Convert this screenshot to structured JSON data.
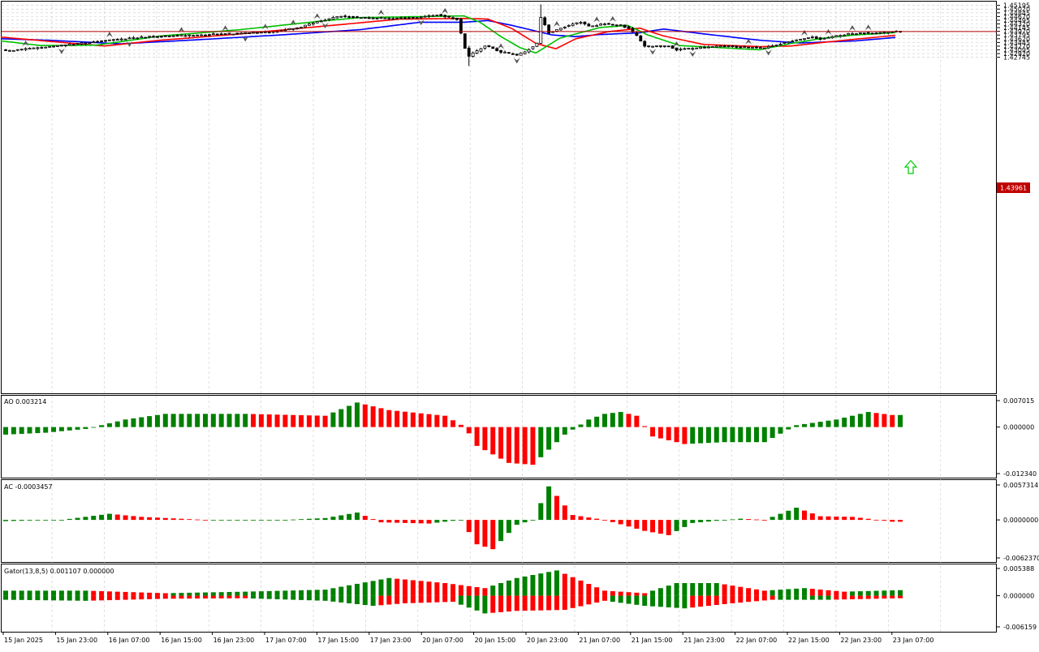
{
  "colors": {
    "bull": "#008000",
    "bear": "#ff0000",
    "alligator_lips": "#00c000",
    "alligator_teeth": "#ff0000",
    "alligator_jaw": "#0000ff",
    "price_line": "#b00000",
    "grid": "#c8c8c8",
    "signal_arrow": "#00cc00"
  },
  "main": {
    "price_badge": "1.43961",
    "signal_icon": "up-arrow-icon"
  },
  "panels": {
    "ao": {
      "label": "AO 0.003214"
    },
    "ac": {
      "label": "AC -0.0003457"
    },
    "gator": {
      "label": "Gator(13,8,5) 0.001107 0.000000"
    }
  },
  "chart_data": [
    {
      "type": "candlestick",
      "title": "",
      "ylim": [
        1.2692,
        1.4522
      ],
      "y_ticks": [
        "1.45195",
        "1.45020",
        "1.44845",
        "1.44670",
        "1.44495",
        "1.44320",
        "1.44145",
        "1.43970",
        "1.43795",
        "1.43620",
        "1.43445",
        "1.43270",
        "1.43095",
        "1.42920",
        "1.42745"
      ],
      "x_ticks": [
        "15 Jan 2025",
        "15 Jan 23:00",
        "16 Jan 07:00",
        "16 Jan 15:00",
        "16 Jan 23:00",
        "17 Jan 07:00",
        "17 Jan 15:00",
        "17 Jan 23:00",
        "20 Jan 07:00",
        "20 Jan 15:00",
        "20 Jan 23:00",
        "21 Jan 07:00",
        "21 Jan 15:00",
        "21 Jan 23:00",
        "22 Jan 07:00",
        "22 Jan 15:00",
        "22 Jan 23:00",
        "23 Jan 07:00"
      ],
      "current_price": 1.43961,
      "close_anchors": [
        [
          0,
          1.4305
        ],
        [
          12,
          1.4326
        ],
        [
          24,
          1.4352
        ],
        [
          36,
          1.4372
        ],
        [
          48,
          1.438
        ],
        [
          58,
          1.4387
        ],
        [
          66,
          1.4393
        ],
        [
          74,
          1.4418
        ],
        [
          78,
          1.4442
        ],
        [
          84,
          1.447
        ],
        [
          88,
          1.4462
        ],
        [
          96,
          1.4458
        ],
        [
          102,
          1.4462
        ],
        [
          108,
          1.4475
        ],
        [
          113,
          1.4455
        ],
        [
          115,
          1.4318
        ],
        [
          116,
          1.428
        ],
        [
          120,
          1.433
        ],
        [
          124,
          1.43
        ],
        [
          128,
          1.4285
        ],
        [
          130,
          1.43
        ],
        [
          133,
          1.434
        ],
        [
          134,
          1.4462
        ],
        [
          136,
          1.439
        ],
        [
          140,
          1.442
        ],
        [
          144,
          1.4442
        ],
        [
          146,
          1.442
        ],
        [
          150,
          1.4432
        ],
        [
          154,
          1.4425
        ],
        [
          156,
          1.441
        ],
        [
          158,
          1.4375
        ],
        [
          160,
          1.4325
        ],
        [
          166,
          1.433
        ],
        [
          168,
          1.431
        ],
        [
          174,
          1.432
        ],
        [
          180,
          1.4327
        ],
        [
          186,
          1.4322
        ],
        [
          190,
          1.4318
        ],
        [
          196,
          1.435
        ],
        [
          202,
          1.437
        ],
        [
          204,
          1.436
        ],
        [
          210,
          1.4382
        ],
        [
          214,
          1.439
        ],
        [
          218,
          1.4388
        ],
        [
          222,
          1.4396
        ]
      ],
      "lips_anchors": [
        [
          0,
          1.4352
        ],
        [
          10,
          1.433
        ],
        [
          24,
          1.4332
        ],
        [
          40,
          1.4375
        ],
        [
          60,
          1.4405
        ],
        [
          80,
          1.4445
        ],
        [
          90,
          1.4462
        ],
        [
          100,
          1.4465
        ],
        [
          116,
          1.447
        ],
        [
          120,
          1.444
        ],
        [
          125,
          1.4375
        ],
        [
          130,
          1.432
        ],
        [
          134,
          1.4295
        ],
        [
          140,
          1.4365
        ],
        [
          150,
          1.4415
        ],
        [
          157,
          1.4425
        ],
        [
          162,
          1.438
        ],
        [
          170,
          1.433
        ],
        [
          180,
          1.432
        ],
        [
          190,
          1.431
        ],
        [
          198,
          1.434
        ],
        [
          206,
          1.4365
        ],
        [
          214,
          1.438
        ],
        [
          224,
          1.4391
        ]
      ],
      "teeth_anchors": [
        [
          0,
          1.437
        ],
        [
          12,
          1.435
        ],
        [
          26,
          1.4328
        ],
        [
          40,
          1.4355
        ],
        [
          60,
          1.4385
        ],
        [
          80,
          1.442
        ],
        [
          100,
          1.4455
        ],
        [
          116,
          1.4458
        ],
        [
          122,
          1.4455
        ],
        [
          128,
          1.441
        ],
        [
          134,
          1.434
        ],
        [
          139,
          1.4315
        ],
        [
          144,
          1.4362
        ],
        [
          152,
          1.4395
        ],
        [
          160,
          1.4412
        ],
        [
          166,
          1.4375
        ],
        [
          176,
          1.4335
        ],
        [
          190,
          1.4325
        ],
        [
          198,
          1.4328
        ],
        [
          206,
          1.4345
        ],
        [
          214,
          1.436
        ],
        [
          224,
          1.4378
        ]
      ],
      "jaw_anchors": [
        [
          0,
          1.4362
        ],
        [
          12,
          1.4355
        ],
        [
          30,
          1.4338
        ],
        [
          50,
          1.4358
        ],
        [
          70,
          1.438
        ],
        [
          90,
          1.4405
        ],
        [
          105,
          1.444
        ],
        [
          116,
          1.444
        ],
        [
          122,
          1.4448
        ],
        [
          128,
          1.4425
        ],
        [
          138,
          1.438
        ],
        [
          144,
          1.4372
        ],
        [
          150,
          1.4382
        ],
        [
          160,
          1.439
        ],
        [
          166,
          1.4408
        ],
        [
          176,
          1.4385
        ],
        [
          190,
          1.4355
        ],
        [
          200,
          1.4342
        ],
        [
          214,
          1.4352
        ],
        [
          224,
          1.4368
        ]
      ]
    },
    {
      "type": "histogram",
      "title": "AO 0.003214",
      "ylim": [
        -0.01234,
        0.007015
      ],
      "y_ticks": [
        "0.007015",
        "0.000000",
        "-0.012340"
      ],
      "anchors": [
        [
          0,
          -0.002
        ],
        [
          10,
          -0.0015
        ],
        [
          20,
          -0.0005
        ],
        [
          30,
          0.002
        ],
        [
          40,
          0.0035
        ],
        [
          60,
          0.0035
        ],
        [
          80,
          0.003
        ],
        [
          88,
          0.0065
        ],
        [
          96,
          0.0045
        ],
        [
          110,
          0.003
        ],
        [
          115,
          0.0
        ],
        [
          118,
          -0.005
        ],
        [
          126,
          -0.0095
        ],
        [
          132,
          -0.01
        ],
        [
          140,
          -0.002
        ],
        [
          146,
          0.002
        ],
        [
          150,
          0.0035
        ],
        [
          154,
          0.004
        ],
        [
          158,
          0.003
        ],
        [
          162,
          -0.0025
        ],
        [
          170,
          -0.0045
        ],
        [
          180,
          -0.004
        ],
        [
          190,
          -0.004
        ],
        [
          198,
          0.0005
        ],
        [
          208,
          0.002
        ],
        [
          216,
          0.004
        ],
        [
          222,
          0.0032
        ]
      ]
    },
    {
      "type": "histogram",
      "title": "AC -0.0003457",
      "ylim": [
        -0.006237,
        0.0057314
      ],
      "y_ticks": [
        "0.0057314",
        "0.0000000",
        "-0.0062370"
      ],
      "anchors": [
        [
          0,
          -0.0002
        ],
        [
          14,
          0.0
        ],
        [
          20,
          0.0005
        ],
        [
          26,
          0.001
        ],
        [
          34,
          0.0005
        ],
        [
          50,
          0.0
        ],
        [
          70,
          0.0
        ],
        [
          80,
          0.0003
        ],
        [
          88,
          0.0012
        ],
        [
          94,
          -0.0004
        ],
        [
          106,
          -0.0006
        ],
        [
          114,
          0.0
        ],
        [
          118,
          -0.004
        ],
        [
          122,
          -0.0048
        ],
        [
          128,
          -0.0008
        ],
        [
          132,
          0.0
        ],
        [
          136,
          0.0055
        ],
        [
          142,
          0.0008
        ],
        [
          150,
          0.0
        ],
        [
          160,
          -0.0018
        ],
        [
          166,
          -0.0025
        ],
        [
          172,
          -0.0005
        ],
        [
          184,
          0.0002
        ],
        [
          190,
          0.0
        ],
        [
          198,
          0.002
        ],
        [
          204,
          0.0006
        ],
        [
          212,
          0.0005
        ],
        [
          222,
          -0.0003
        ]
      ]
    },
    {
      "type": "histogram",
      "title": "Gator(13,8,5) 0.001107 0.000000",
      "ylim": [
        -0.006159,
        0.005388
      ],
      "y_ticks": [
        "0.005388",
        "0.000000",
        "-0.006159"
      ],
      "upper_anchors": [
        [
          0,
          0.001
        ],
        [
          20,
          0.001
        ],
        [
          40,
          0.0005
        ],
        [
          60,
          0.0008
        ],
        [
          80,
          0.0012
        ],
        [
          96,
          0.0035
        ],
        [
          110,
          0.0025
        ],
        [
          120,
          0.0015
        ],
        [
          128,
          0.0035
        ],
        [
          138,
          0.005
        ],
        [
          150,
          0.001
        ],
        [
          160,
          0.0005
        ],
        [
          168,
          0.0025
        ],
        [
          178,
          0.0025
        ],
        [
          190,
          0.001
        ],
        [
          200,
          0.0015
        ],
        [
          210,
          0.0008
        ],
        [
          224,
          0.0011
        ]
      ],
      "lower_anchors": [
        [
          0,
          -0.0008
        ],
        [
          20,
          -0.001
        ],
        [
          40,
          -0.0006
        ],
        [
          60,
          -0.0005
        ],
        [
          80,
          -0.001
        ],
        [
          92,
          -0.002
        ],
        [
          100,
          -0.0015
        ],
        [
          112,
          -0.0012
        ],
        [
          120,
          -0.0035
        ],
        [
          128,
          -0.003
        ],
        [
          140,
          -0.0028
        ],
        [
          150,
          -0.001
        ],
        [
          160,
          -0.002
        ],
        [
          170,
          -0.0025
        ],
        [
          182,
          -0.0015
        ],
        [
          192,
          -0.0008
        ],
        [
          206,
          -0.0008
        ],
        [
          224,
          -0.0005
        ]
      ]
    }
  ]
}
